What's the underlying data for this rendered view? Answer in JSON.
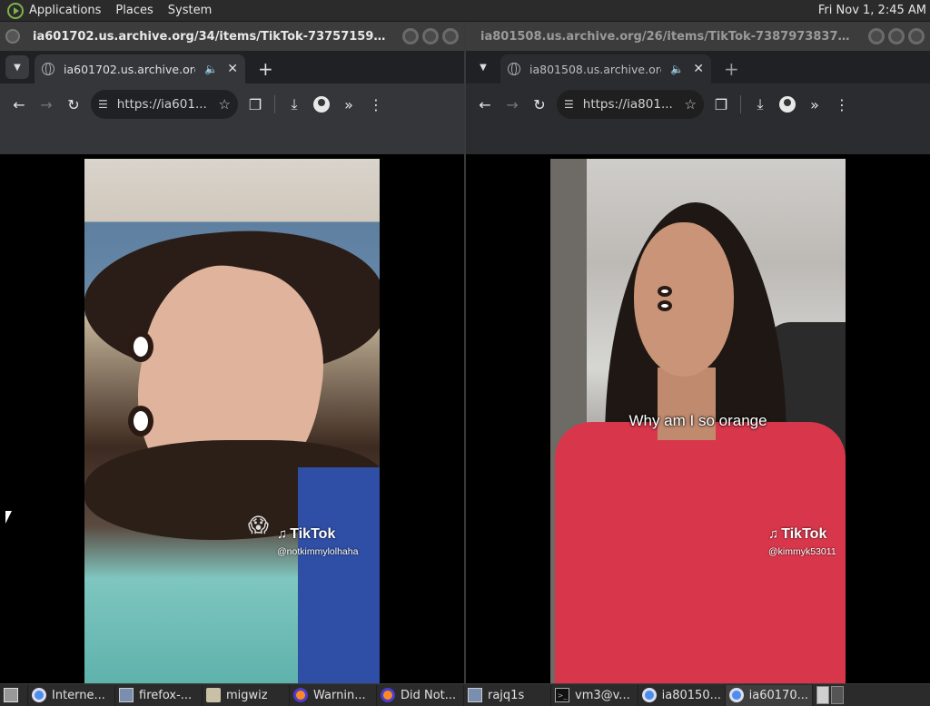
{
  "top_panel": {
    "menus": [
      "Applications",
      "Places",
      "System"
    ],
    "clock": "Fri Nov 1,  2:45 AM"
  },
  "left_window": {
    "title": "ia601702.us.archive.org/34/items/TikTok-737571599941430...",
    "tab_title": "ia601702.us.archive.org/3",
    "url": "https://ia601...",
    "video": {
      "emoji": "😱",
      "brand": "TikTok",
      "handle": "@notkimmylolhaha"
    }
  },
  "right_window": {
    "title": "ia801508.us.archive.org/26/items/TikTok-738797383789324...",
    "tab_title": "ia801508.us.archive.org/",
    "url": "https://ia801...",
    "video": {
      "caption": "Why am I so orange",
      "brand": "TikTok",
      "handle": "@kimmyk53011"
    }
  },
  "taskbar": {
    "tasks": [
      {
        "label": "Interne...",
        "icon": "chrome-icon",
        "active": false
      },
      {
        "label": "firefox-...",
        "icon": "image-icon",
        "active": false
      },
      {
        "label": "migwiz",
        "icon": "folder-icon",
        "active": false
      },
      {
        "label": "Warnin...",
        "icon": "firefox-icon",
        "active": false
      },
      {
        "label": "Did Not...",
        "icon": "firefox-icon",
        "active": false
      },
      {
        "label": "rajq1s",
        "icon": "image-icon",
        "active": false
      },
      {
        "label": "vm3@v...",
        "icon": "terminal-icon",
        "active": false
      },
      {
        "label": "ia80150...",
        "icon": "chrome-icon",
        "active": false
      },
      {
        "label": "ia60170...",
        "icon": "chrome-icon",
        "active": true
      }
    ]
  }
}
